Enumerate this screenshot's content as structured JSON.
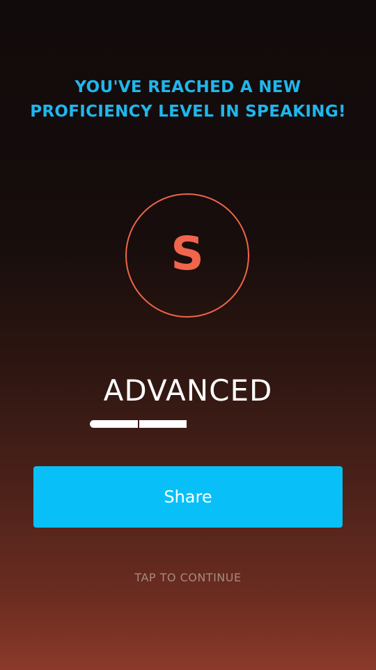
{
  "headline": "YOU'VE REACHED A NEW PROFICIENCY LEVEL IN SPEAKING!",
  "badge": {
    "letter": "S",
    "skill": "speaking",
    "color": "#f0654c"
  },
  "level": {
    "label": "ADVANCED",
    "progress_segments_filled": 2,
    "progress_segments_total": 4
  },
  "share_button": {
    "label": "Share",
    "color": "#08c0f7"
  },
  "continue_hint": "TAP TO CONTINUE",
  "colors": {
    "headline": "#1fb7ec",
    "background_top": "#120b0b",
    "background_bottom": "#8a3a2b"
  }
}
